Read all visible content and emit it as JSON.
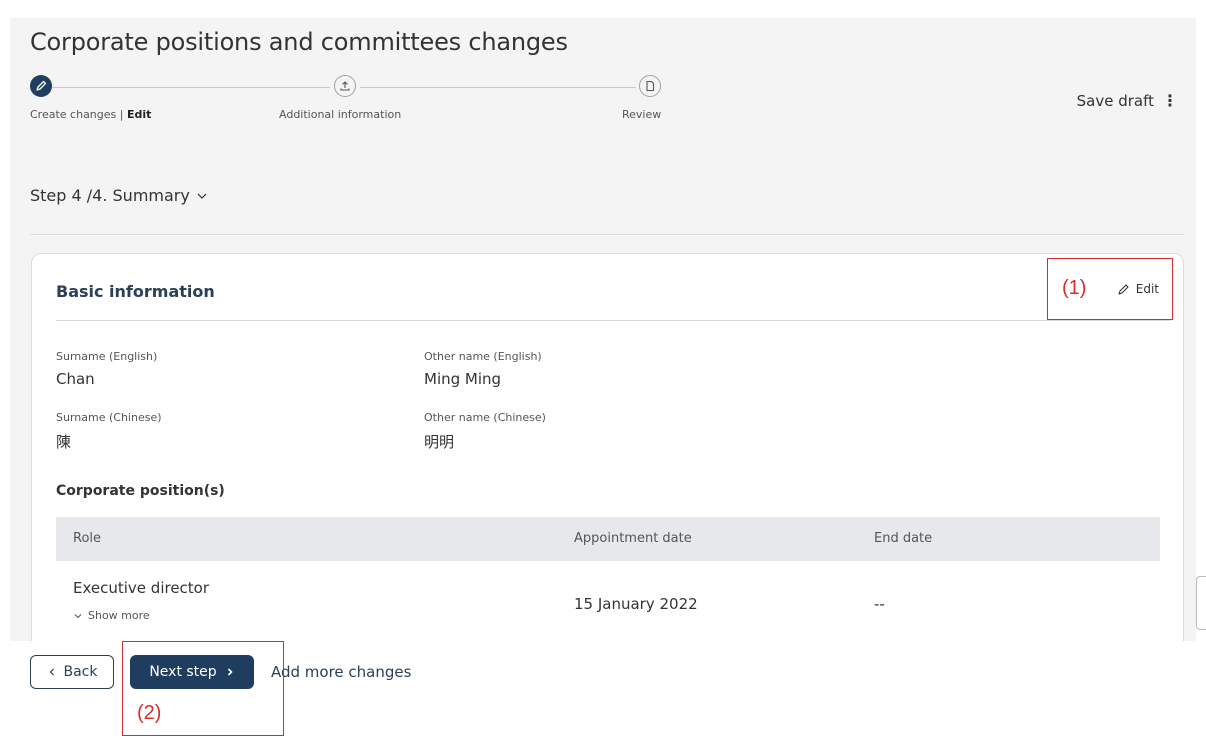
{
  "header": {
    "title": "Corporate positions and committees changes",
    "save_draft": "Save draft",
    "steps": [
      {
        "label": "Create changes | ",
        "suffix": "Edit"
      },
      {
        "label": "Additional information"
      },
      {
        "label": "Review"
      }
    ]
  },
  "summary": {
    "step_label": "Step 4 /4. Summary"
  },
  "card": {
    "title": "Basic information",
    "edit_label": "Edit",
    "fields": {
      "surname_en_label": "Surname (English)",
      "surname_en_value": "Chan",
      "other_name_en_label": "Other name (English)",
      "other_name_en_value": "Ming Ming",
      "surname_zh_label": "Surname (Chinese)",
      "surname_zh_value": "陳",
      "other_name_zh_label": "Other name (Chinese)",
      "other_name_zh_value": "明明"
    },
    "positions_title": "Corporate position(s)",
    "table": {
      "columns": [
        "Role",
        "Appointment date",
        "End date"
      ],
      "rows": [
        {
          "role": "Executive director",
          "appointment_date": "15 January 2022",
          "end_date": "--",
          "show_more": "Show more"
        }
      ]
    }
  },
  "footer": {
    "back": "Back",
    "next": "Next step",
    "add_more": "Add more changes"
  },
  "annotations": {
    "edit_marker": "(1)",
    "next_marker": "(2)"
  },
  "colors": {
    "primary": "#1f3d5e",
    "annotation": "#d32f2f",
    "panel_bg": "#f4f4f4"
  }
}
